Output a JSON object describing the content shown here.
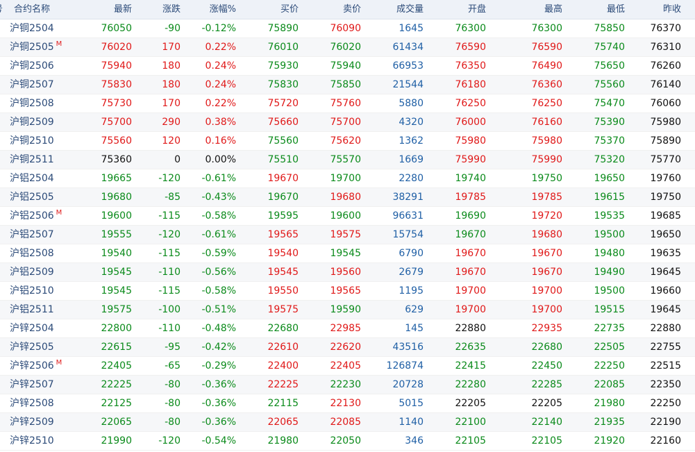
{
  "colors": {
    "up": "#e01818",
    "down": "#0a8a1a",
    "flat": "#111111",
    "volume": "#1f5fa5",
    "name": "#2b4a78",
    "header_bg": "#eef2f8"
  },
  "header": {
    "num": "号",
    "name": "合约名称",
    "last": "最新",
    "chg": "涨跌",
    "pct": "涨幅%",
    "bid": "买价",
    "ask": "卖价",
    "vol": "成交量",
    "open": "开盘",
    "high": "最高",
    "low": "最低",
    "prev": "昨收"
  },
  "rows": [
    {
      "name": "沪铜2504",
      "m": "",
      "last": "76050",
      "chg": "-90",
      "pct": "-0.12%",
      "bid": "75890",
      "ask": "76090",
      "vol": "1645",
      "open": "76300",
      "high": "76300",
      "low": "75850",
      "prev": "76370",
      "c": {
        "last": "down",
        "chg": "down",
        "pct": "down",
        "bid": "down",
        "ask": "up",
        "open": "down",
        "high": "down",
        "low": "down"
      }
    },
    {
      "name": "沪铜2505",
      "m": "M",
      "last": "76020",
      "chg": "170",
      "pct": "0.22%",
      "bid": "76010",
      "ask": "76020",
      "vol": "61434",
      "open": "76590",
      "high": "76590",
      "low": "75740",
      "prev": "76310",
      "c": {
        "last": "up",
        "chg": "up",
        "pct": "up",
        "bid": "down",
        "ask": "down",
        "open": "up",
        "high": "up",
        "low": "down"
      }
    },
    {
      "name": "沪铜2506",
      "m": "",
      "last": "75940",
      "chg": "180",
      "pct": "0.24%",
      "bid": "75930",
      "ask": "75940",
      "vol": "66953",
      "open": "76350",
      "high": "76490",
      "low": "75650",
      "prev": "76260",
      "c": {
        "last": "up",
        "chg": "up",
        "pct": "up",
        "bid": "down",
        "ask": "down",
        "open": "up",
        "high": "up",
        "low": "down"
      }
    },
    {
      "name": "沪铜2507",
      "m": "",
      "last": "75830",
      "chg": "180",
      "pct": "0.24%",
      "bid": "75830",
      "ask": "75850",
      "vol": "21544",
      "open": "76180",
      "high": "76360",
      "low": "75560",
      "prev": "76140",
      "c": {
        "last": "up",
        "chg": "up",
        "pct": "up",
        "bid": "down",
        "ask": "down",
        "open": "up",
        "high": "up",
        "low": "down"
      }
    },
    {
      "name": "沪铜2508",
      "m": "",
      "last": "75730",
      "chg": "170",
      "pct": "0.22%",
      "bid": "75720",
      "ask": "75760",
      "vol": "5880",
      "open": "76250",
      "high": "76250",
      "low": "75470",
      "prev": "76060",
      "c": {
        "last": "up",
        "chg": "up",
        "pct": "up",
        "bid": "up",
        "ask": "up",
        "open": "up",
        "high": "up",
        "low": "down"
      }
    },
    {
      "name": "沪铜2509",
      "m": "",
      "last": "75700",
      "chg": "290",
      "pct": "0.38%",
      "bid": "75660",
      "ask": "75700",
      "vol": "4320",
      "open": "76000",
      "high": "76160",
      "low": "75390",
      "prev": "75980",
      "c": {
        "last": "up",
        "chg": "up",
        "pct": "up",
        "bid": "up",
        "ask": "up",
        "open": "up",
        "high": "up",
        "low": "down"
      }
    },
    {
      "name": "沪铜2510",
      "m": "",
      "last": "75560",
      "chg": "120",
      "pct": "0.16%",
      "bid": "75560",
      "ask": "75620",
      "vol": "1362",
      "open": "75980",
      "high": "75980",
      "low": "75370",
      "prev": "75890",
      "c": {
        "last": "up",
        "chg": "up",
        "pct": "up",
        "bid": "down",
        "ask": "up",
        "open": "up",
        "high": "up",
        "low": "down"
      }
    },
    {
      "name": "沪铜2511",
      "m": "",
      "last": "75360",
      "chg": "0",
      "pct": "0.00%",
      "bid": "75510",
      "ask": "75570",
      "vol": "1669",
      "open": "75990",
      "high": "75990",
      "low": "75320",
      "prev": "75770",
      "c": {
        "last": "flat",
        "chg": "flat",
        "pct": "flat",
        "bid": "down",
        "ask": "down",
        "open": "up",
        "high": "up",
        "low": "down"
      }
    },
    {
      "name": "沪铝2504",
      "m": "",
      "last": "19665",
      "chg": "-120",
      "pct": "-0.61%",
      "bid": "19670",
      "ask": "19700",
      "vol": "2280",
      "open": "19740",
      "high": "19750",
      "low": "19650",
      "prev": "19760",
      "c": {
        "last": "down",
        "chg": "down",
        "pct": "down",
        "bid": "up",
        "ask": "down",
        "open": "down",
        "high": "down",
        "low": "down"
      }
    },
    {
      "name": "沪铝2505",
      "m": "",
      "last": "19680",
      "chg": "-85",
      "pct": "-0.43%",
      "bid": "19670",
      "ask": "19680",
      "vol": "38291",
      "open": "19785",
      "high": "19785",
      "low": "19615",
      "prev": "19750",
      "c": {
        "last": "down",
        "chg": "down",
        "pct": "down",
        "bid": "down",
        "ask": "up",
        "open": "up",
        "high": "up",
        "low": "down"
      }
    },
    {
      "name": "沪铝2506",
      "m": "M",
      "last": "19600",
      "chg": "-115",
      "pct": "-0.58%",
      "bid": "19595",
      "ask": "19600",
      "vol": "96631",
      "open": "19690",
      "high": "19720",
      "low": "19535",
      "prev": "19685",
      "c": {
        "last": "down",
        "chg": "down",
        "pct": "down",
        "bid": "down",
        "ask": "down",
        "open": "down",
        "high": "up",
        "low": "down"
      }
    },
    {
      "name": "沪铝2507",
      "m": "",
      "last": "19555",
      "chg": "-120",
      "pct": "-0.61%",
      "bid": "19565",
      "ask": "19575",
      "vol": "15754",
      "open": "19670",
      "high": "19680",
      "low": "19500",
      "prev": "19650",
      "c": {
        "last": "down",
        "chg": "down",
        "pct": "down",
        "bid": "up",
        "ask": "up",
        "open": "down",
        "high": "up",
        "low": "down"
      }
    },
    {
      "name": "沪铝2508",
      "m": "",
      "last": "19540",
      "chg": "-115",
      "pct": "-0.59%",
      "bid": "19540",
      "ask": "19545",
      "vol": "6790",
      "open": "19670",
      "high": "19670",
      "low": "19480",
      "prev": "19635",
      "c": {
        "last": "down",
        "chg": "down",
        "pct": "down",
        "bid": "up",
        "ask": "down",
        "open": "up",
        "high": "up",
        "low": "down"
      }
    },
    {
      "name": "沪铝2509",
      "m": "",
      "last": "19545",
      "chg": "-110",
      "pct": "-0.56%",
      "bid": "19545",
      "ask": "19560",
      "vol": "2679",
      "open": "19670",
      "high": "19670",
      "low": "19490",
      "prev": "19645",
      "c": {
        "last": "down",
        "chg": "down",
        "pct": "down",
        "bid": "up",
        "ask": "up",
        "open": "up",
        "high": "up",
        "low": "down"
      }
    },
    {
      "name": "沪铝2510",
      "m": "",
      "last": "19545",
      "chg": "-115",
      "pct": "-0.58%",
      "bid": "19550",
      "ask": "19565",
      "vol": "1195",
      "open": "19700",
      "high": "19700",
      "low": "19500",
      "prev": "19660",
      "c": {
        "last": "down",
        "chg": "down",
        "pct": "down",
        "bid": "up",
        "ask": "up",
        "open": "up",
        "high": "up",
        "low": "down"
      }
    },
    {
      "name": "沪铝2511",
      "m": "",
      "last": "19575",
      "chg": "-100",
      "pct": "-0.51%",
      "bid": "19575",
      "ask": "19590",
      "vol": "629",
      "open": "19700",
      "high": "19700",
      "low": "19515",
      "prev": "19645",
      "c": {
        "last": "down",
        "chg": "down",
        "pct": "down",
        "bid": "up",
        "ask": "down",
        "open": "up",
        "high": "up",
        "low": "down"
      }
    },
    {
      "name": "沪锌2504",
      "m": "",
      "last": "22800",
      "chg": "-110",
      "pct": "-0.48%",
      "bid": "22680",
      "ask": "22985",
      "vol": "145",
      "open": "22880",
      "high": "22935",
      "low": "22735",
      "prev": "22880",
      "c": {
        "last": "down",
        "chg": "down",
        "pct": "down",
        "bid": "down",
        "ask": "up",
        "open": "flat",
        "high": "up",
        "low": "down"
      }
    },
    {
      "name": "沪锌2505",
      "m": "",
      "last": "22615",
      "chg": "-95",
      "pct": "-0.42%",
      "bid": "22610",
      "ask": "22620",
      "vol": "43516",
      "open": "22635",
      "high": "22680",
      "low": "22505",
      "prev": "22755",
      "c": {
        "last": "down",
        "chg": "down",
        "pct": "down",
        "bid": "up",
        "ask": "up",
        "open": "down",
        "high": "down",
        "low": "down"
      }
    },
    {
      "name": "沪锌2506",
      "m": "M",
      "last": "22405",
      "chg": "-65",
      "pct": "-0.29%",
      "bid": "22400",
      "ask": "22405",
      "vol": "126874",
      "open": "22415",
      "high": "22450",
      "low": "22250",
      "prev": "22515",
      "c": {
        "last": "down",
        "chg": "down",
        "pct": "down",
        "bid": "up",
        "ask": "up",
        "open": "down",
        "high": "down",
        "low": "down"
      }
    },
    {
      "name": "沪锌2507",
      "m": "",
      "last": "22225",
      "chg": "-80",
      "pct": "-0.36%",
      "bid": "22225",
      "ask": "22230",
      "vol": "20728",
      "open": "22280",
      "high": "22285",
      "low": "22085",
      "prev": "22350",
      "c": {
        "last": "down",
        "chg": "down",
        "pct": "down",
        "bid": "up",
        "ask": "down",
        "open": "down",
        "high": "down",
        "low": "down"
      }
    },
    {
      "name": "沪锌2508",
      "m": "",
      "last": "22125",
      "chg": "-80",
      "pct": "-0.36%",
      "bid": "22115",
      "ask": "22130",
      "vol": "5015",
      "open": "22205",
      "high": "22205",
      "low": "21980",
      "prev": "22250",
      "c": {
        "last": "down",
        "chg": "down",
        "pct": "down",
        "bid": "down",
        "ask": "up",
        "open": "flat",
        "high": "flat",
        "low": "down"
      }
    },
    {
      "name": "沪锌2509",
      "m": "",
      "last": "22065",
      "chg": "-80",
      "pct": "-0.36%",
      "bid": "22065",
      "ask": "22085",
      "vol": "1140",
      "open": "22100",
      "high": "22140",
      "low": "21935",
      "prev": "22190",
      "c": {
        "last": "down",
        "chg": "down",
        "pct": "down",
        "bid": "up",
        "ask": "up",
        "open": "down",
        "high": "down",
        "low": "down"
      }
    },
    {
      "name": "沪锌2510",
      "m": "",
      "last": "21990",
      "chg": "-120",
      "pct": "-0.54%",
      "bid": "21980",
      "ask": "22050",
      "vol": "346",
      "open": "22105",
      "high": "22105",
      "low": "21920",
      "prev": "22160",
      "c": {
        "last": "down",
        "chg": "down",
        "pct": "down",
        "bid": "down",
        "ask": "down",
        "open": "down",
        "high": "down",
        "low": "down"
      }
    }
  ]
}
